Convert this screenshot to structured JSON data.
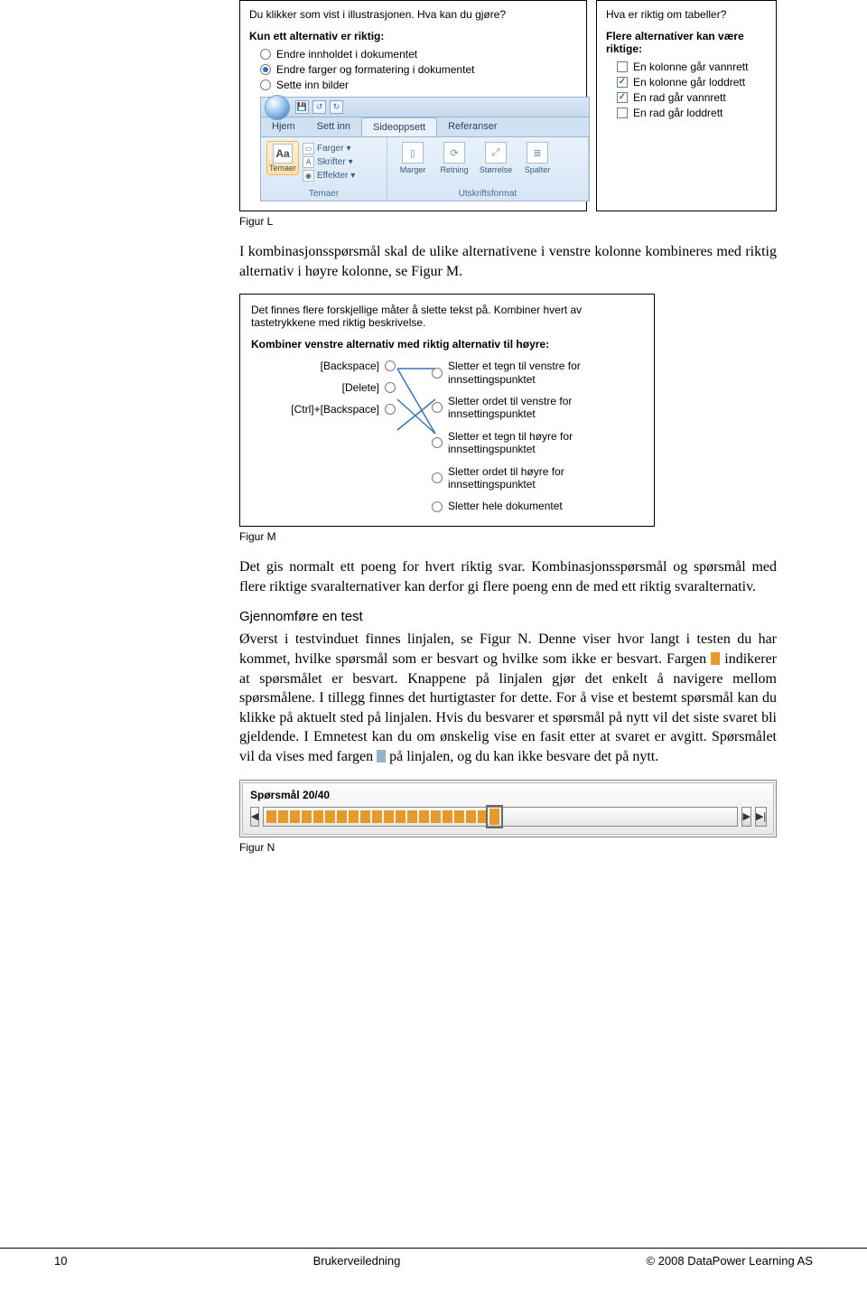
{
  "quiz_left": {
    "question": "Du klikker som vist i illustrasjonen. Hva kan du gjøre?",
    "instr": "Kun ett alternativ er riktig:",
    "options": [
      {
        "label": "Endre innholdet i dokumentet",
        "selected": false
      },
      {
        "label": "Endre farger og formatering i dokumentet",
        "selected": true
      },
      {
        "label": "Sette inn bilder",
        "selected": false
      }
    ]
  },
  "quiz_right": {
    "question": "Hva er riktig om tabeller?",
    "instr": "Flere alternativer kan være riktige:",
    "options": [
      {
        "label": "En kolonne går vannrett",
        "checked": false
      },
      {
        "label": "En kolonne går loddrett",
        "checked": true
      },
      {
        "label": "En rad går vannrett",
        "checked": true
      },
      {
        "label": "En rad går loddrett",
        "checked": false
      }
    ]
  },
  "ribbon": {
    "tabs": [
      "Hjem",
      "Sett inn",
      "Sideoppsett",
      "Referanser"
    ],
    "active_tab": 2,
    "group_temaer": {
      "btn": "Temaer",
      "lines": [
        "Farger",
        "Skrifter",
        "Effekter"
      ],
      "label": "Temaer"
    },
    "group_utskrift": {
      "items": [
        "Marger",
        "Retning",
        "Størrelse",
        "Spalter"
      ],
      "label": "Utskriftsformat"
    }
  },
  "figL_caption": "Figur L",
  "paraL": "I kombinasjonsspørsmål skal de ulike alternativene i venstre kolonne kombineres med riktig alternativ i høyre kolonne, se Figur M.",
  "figM": {
    "intro": "Det finnes flere forskjellige måter å slette tekst på. Kombiner hvert av tastetrykkene med riktig beskrivelse.",
    "instr": "Kombiner venstre alternativ med riktig alternativ til høyre:",
    "left": [
      "[Backspace]",
      "[Delete]",
      "[Ctrl]+[Backspace]"
    ],
    "right": [
      "Sletter et tegn til venstre for innsettingspunktet",
      "Sletter ordet til venstre for innsettingspunktet",
      "Sletter et tegn til høyre for innsettingspunktet",
      "Sletter ordet til høyre for innsettingspunktet",
      "Sletter hele dokumentet"
    ]
  },
  "figM_caption": "Figur M",
  "paraM": "Det gis normalt ett poeng for hvert riktig svar. Kombinasjons­spørsmål og spørsmål med flere riktige svaralternativer kan derfor gi flere poeng enn de med ett riktig svaralternativ.",
  "section_h": "Gjennomføre en test",
  "paraN1a": "Øverst i testvinduet finnes linjalen, se Figur N. Denne viser hvor langt i testen du har kommet, hvilke spørsmål som er besvart og hvilke som ikke er besvart. Fargen ",
  "paraN1b": " indikerer at spørsmålet er besvart. Knappene på linjalen gjør det enkelt å navigere mellom spørsmålene. I tillegg finnes det hurtigtaster for dette. For å vise et bestemt spørsmål kan du klikke på aktuelt sted på linjalen. Hvis du besvarer et spørsmål på nytt vil det siste svaret bli gjeldende. I Emnetest kan du om ønskelig vise en fasit etter at svaret er avgitt. Spørsmålet vil da vises med fargen ",
  "paraN1c": " på linjalen, og du kan ikke besvare det på nytt.",
  "figN": {
    "title": "Spørsmål 20/40",
    "total": 40,
    "current": 20,
    "answered_upto": 19
  },
  "figN_caption": "Figur N",
  "footer": {
    "page": "10",
    "center": "Brukerveiledning",
    "right": "© 2008 DataPower Learning AS"
  }
}
